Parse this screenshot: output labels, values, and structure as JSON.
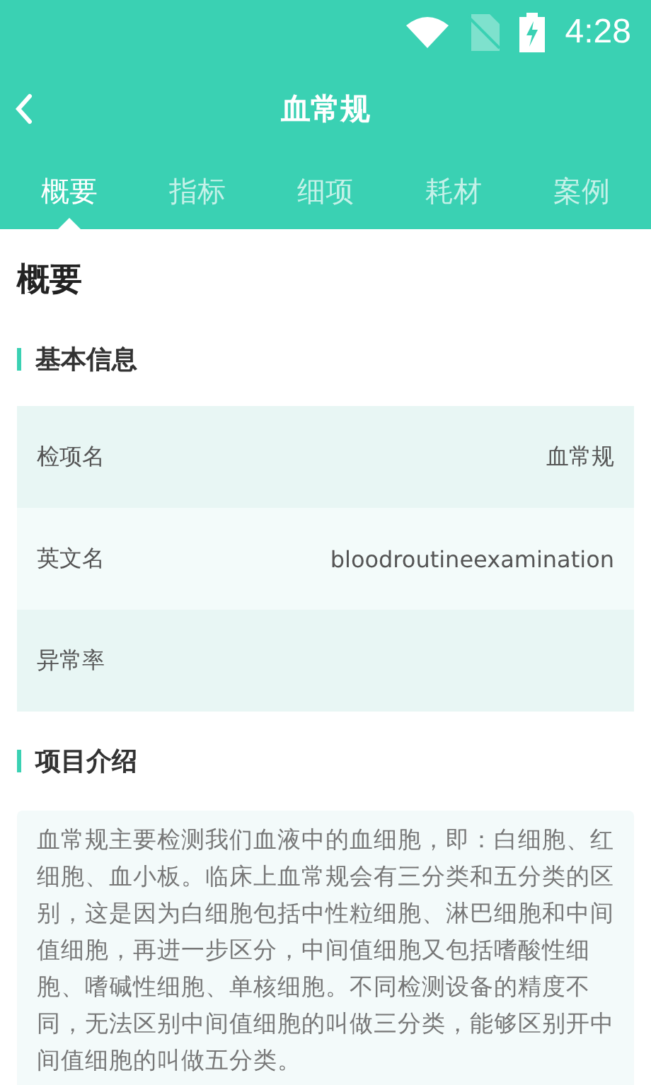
{
  "status_bar": {
    "time": "4:28"
  },
  "header": {
    "title": "血常规"
  },
  "tabs": [
    {
      "label": "概要",
      "selected": true
    },
    {
      "label": "指标",
      "selected": false
    },
    {
      "label": "细项",
      "selected": false
    },
    {
      "label": "耗材",
      "selected": false
    },
    {
      "label": "案例",
      "selected": false
    }
  ],
  "page_title": "概要",
  "sections": [
    {
      "title": "基本信息",
      "kind": "table",
      "rows": [
        {
          "label": "检项名",
          "value": "血常规"
        },
        {
          "label": "英文名",
          "value": "bloodroutineexamination"
        },
        {
          "label": "异常率"
        }
      ]
    },
    {
      "title": "项目介绍",
      "kind": "text",
      "text": "血常规主要检测我们血液中的血细胞，即：白细胞、红细胞、血小板。临床上血常规会有三分类和五分类的区别，这是因为白细胞包括中性粒细胞、淋巴细胞和中间值细胞，再进一步区分，中间值细胞又包括嗜酸性细胞、嗜碱性细胞、单核细胞。不同检测设备的精度不同，无法区别中间值细胞的叫做三分类，能够区别开中间值细胞的叫做五分类。"
    }
  ]
}
